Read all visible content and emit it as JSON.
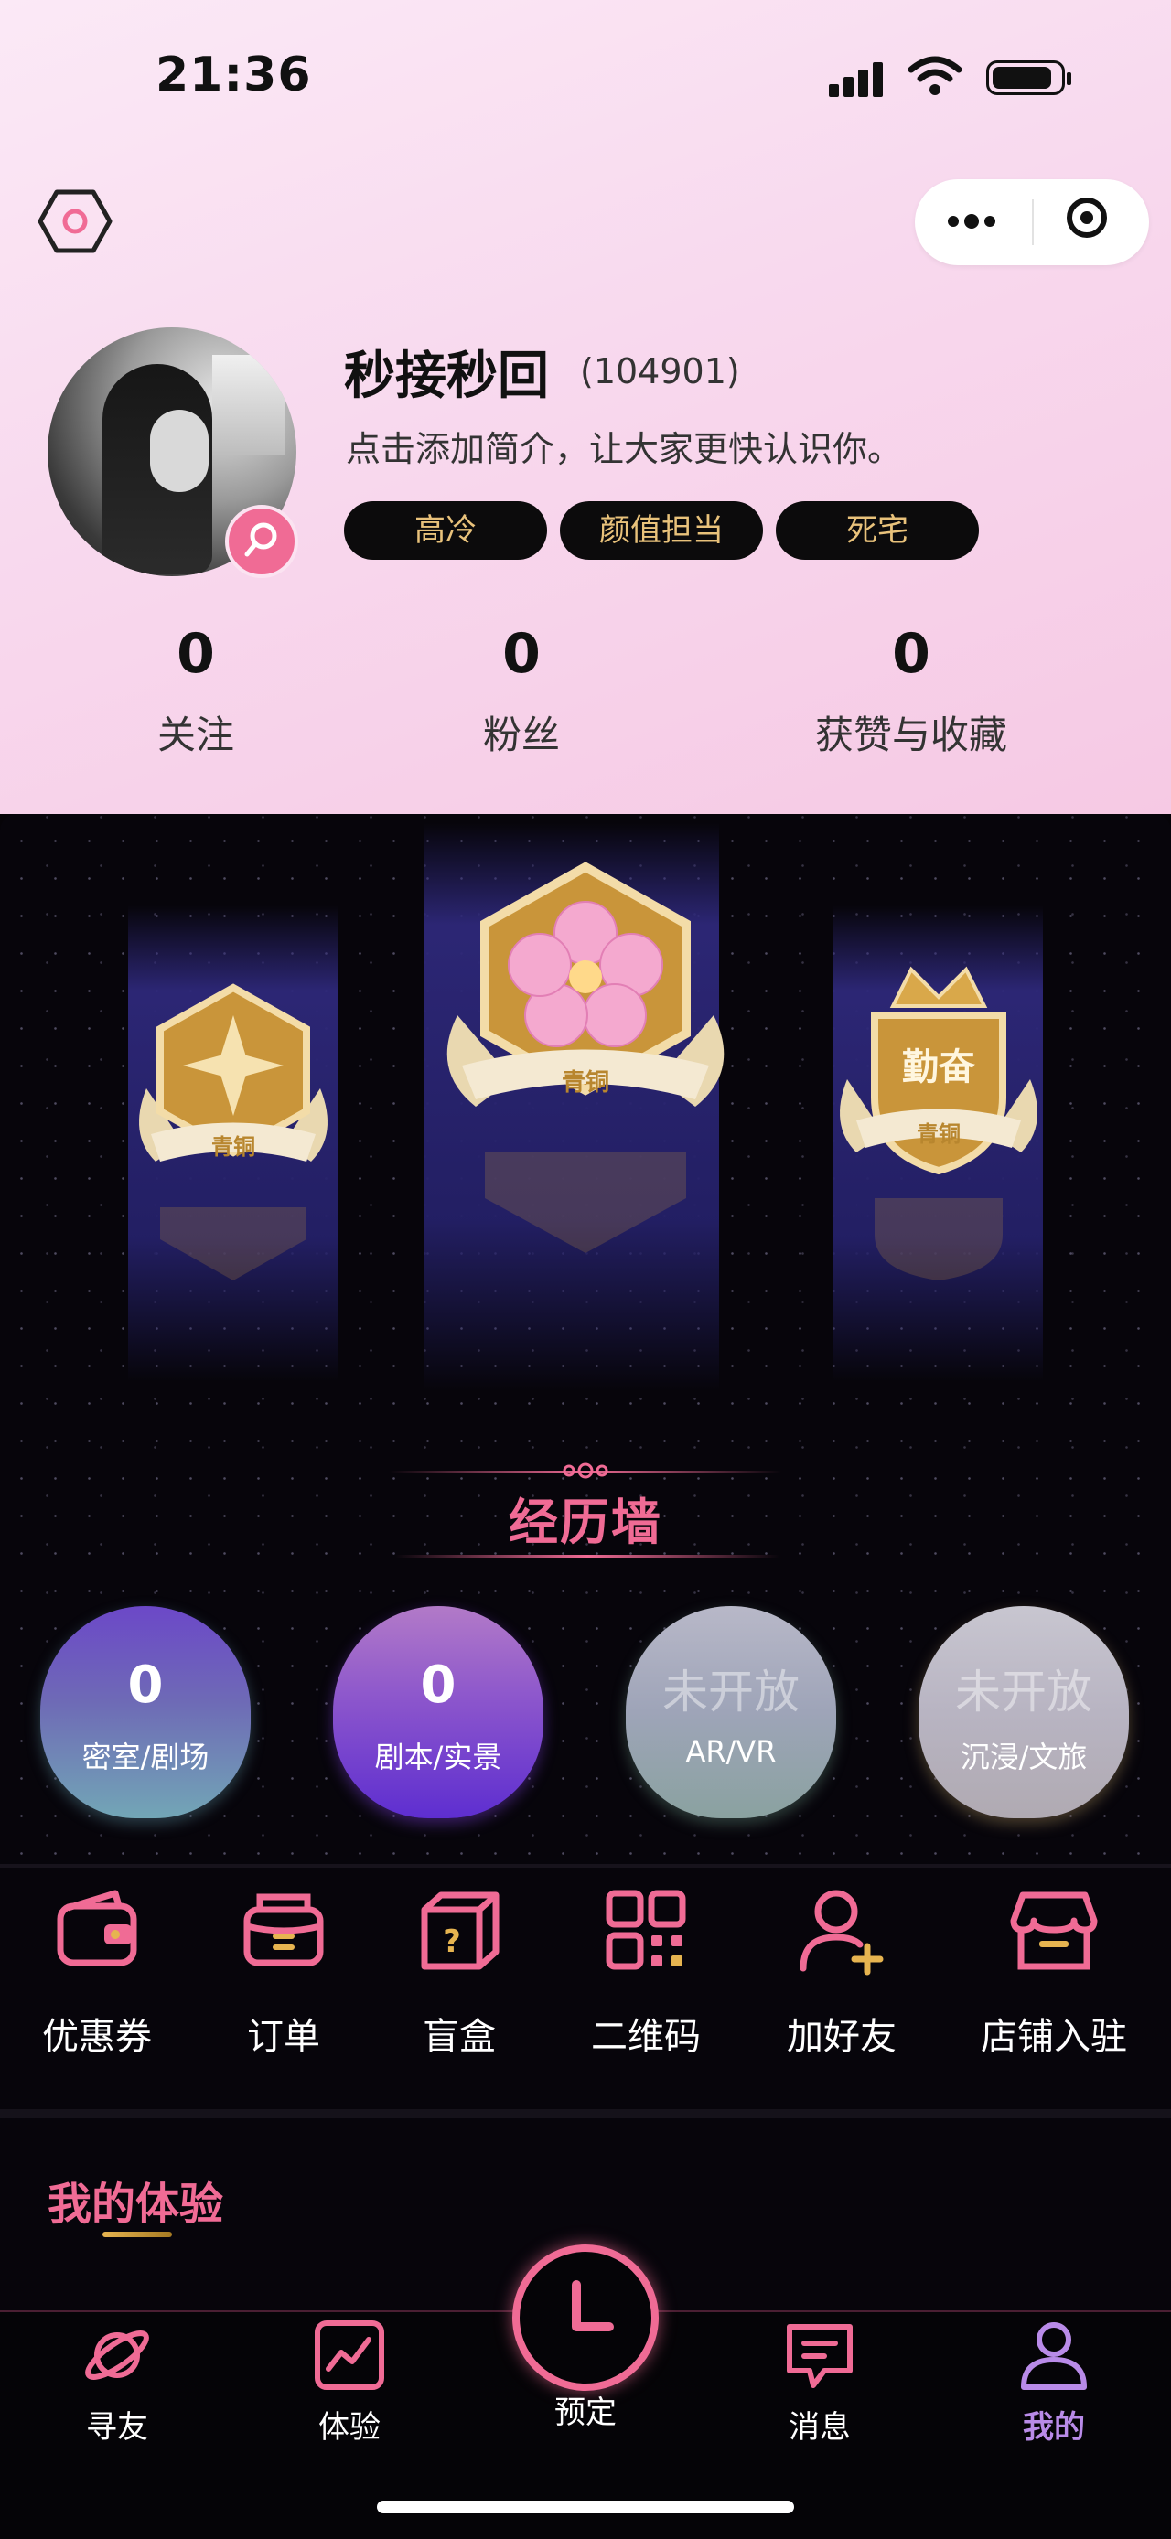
{
  "status_bar": {
    "time": "21:36"
  },
  "profile": {
    "username": "秒接秒回",
    "user_id": "(104901)",
    "bio": "点击添加简介，让大家更快认识你。",
    "tags": [
      "高冷",
      "颜值担当",
      "死宅"
    ]
  },
  "stats": [
    {
      "value": "0",
      "label": "关注"
    },
    {
      "value": "0",
      "label": "粉丝"
    },
    {
      "value": "0",
      "label": "获赞与收藏"
    }
  ],
  "medals": [
    {
      "name": "star-medal",
      "caption": "青铜"
    },
    {
      "name": "flower-medal",
      "caption": "青铜"
    },
    {
      "name": "crown-medal",
      "title": "勤奋",
      "caption": "青铜"
    }
  ],
  "experience_wall": {
    "title": "经历墙",
    "bubbles": [
      {
        "value": "0",
        "label": "密室/剧场"
      },
      {
        "value": "0",
        "label": "剧本/实景"
      },
      {
        "value": "未开放",
        "label": "AR/VR"
      },
      {
        "value": "未开放",
        "label": "沉浸/文旅"
      }
    ]
  },
  "menu": [
    {
      "label": "优惠券",
      "icon": "wallet-icon"
    },
    {
      "label": "订单",
      "icon": "order-icon"
    },
    {
      "label": "盲盒",
      "icon": "blind-box-icon"
    },
    {
      "label": "二维码",
      "icon": "qrcode-icon"
    },
    {
      "label": "加好友",
      "icon": "add-friend-icon"
    },
    {
      "label": "店铺入驻",
      "icon": "store-icon"
    }
  ],
  "section": {
    "title": "我的体验"
  },
  "tabs": [
    {
      "label": "寻友",
      "icon": "planet-icon"
    },
    {
      "label": "体验",
      "icon": "chart-icon"
    },
    {
      "label": "预定",
      "icon": "clock-icon"
    },
    {
      "label": "消息",
      "icon": "message-icon"
    },
    {
      "label": "我的",
      "icon": "user-icon",
      "active": true
    }
  ],
  "colors": {
    "accent": "#f06b95",
    "tag_text": "#e9c27b",
    "active_tab": "#b98be8",
    "gold": "#c9953a"
  }
}
